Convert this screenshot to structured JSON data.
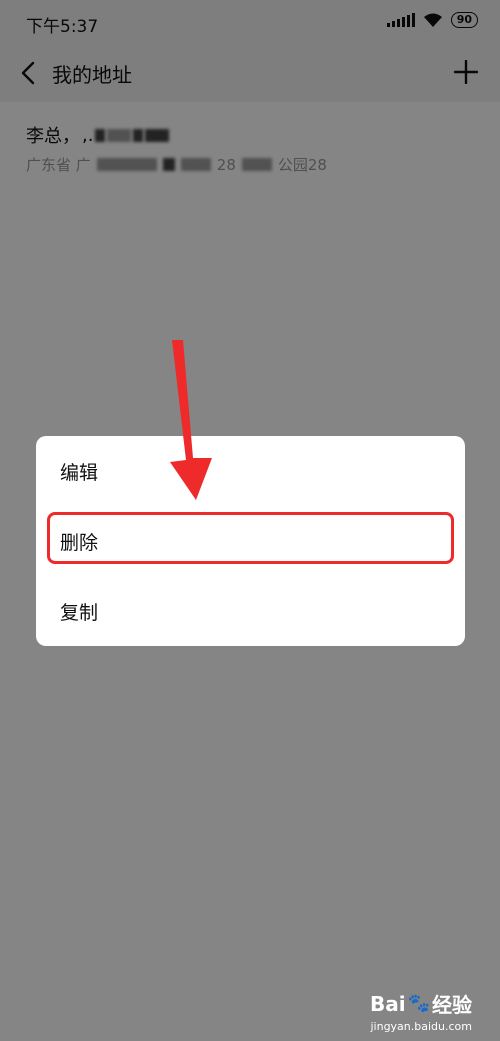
{
  "status_bar": {
    "time": "下午5:37",
    "battery": "90",
    "icons": [
      "signal-icon",
      "wifi-icon",
      "battery-icon"
    ]
  },
  "header": {
    "back_icon": "chevron-left-icon",
    "title": "我的地址",
    "add_icon": "plus-icon"
  },
  "address": {
    "name_prefix": "李总，",
    "name_fragment": ",.",
    "line_text_1": "广东省 广",
    "line_text_2": "28",
    "line_text_3": "公园28"
  },
  "menu": {
    "edit": "编辑",
    "delete": "删除",
    "copy": "复制"
  },
  "annotation": {
    "highlight_color": "#ee2a2a",
    "arrow_color": "#ee2a2a"
  },
  "watermark": {
    "logo_prefix": "Bai",
    "logo_suffix": "经验",
    "url": "jingyan.baidu.com"
  }
}
